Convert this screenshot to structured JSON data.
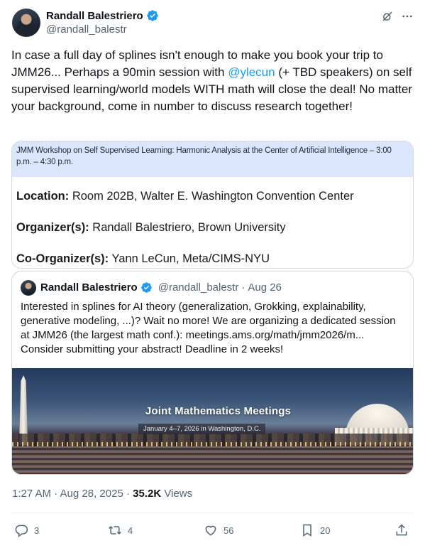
{
  "author": {
    "display_name": "Randall Balestriero",
    "handle": "@randall_balestr"
  },
  "tweet": {
    "text_before_mention": "In case a full day of splines isn't enough to make you book your trip to JMM26... Perhaps a 90min session with ",
    "mention": "@ylecun",
    "text_after_mention": " (+ TBD speakers) on self supervised learning/world models WITH math will close the deal! No matter your background, come in number to discuss research together!"
  },
  "image_card": {
    "header": "JMM Workshop on Self Supervised Learning: Harmonic Analysis at the Center of Artificial Intelligence – 3:00 p.m. – 4:30 p.m.",
    "location_label": "Location:",
    "location_value": " Room 202B, Walter E. Washington Convention Center",
    "organizer_label": "Organizer(s):",
    "organizer_value": " Randall Balestriero, Brown University",
    "coorganizer_label": "Co-Organizer(s):",
    "coorganizer_value": " Yann LeCun, Meta/CIMS-NYU"
  },
  "quote": {
    "display_name": "Randall Balestriero",
    "handle": "@randall_balestr",
    "separator": "·",
    "date": "Aug 26",
    "text": "Interested in splines for AI theory (generalization, Grokking, explainability, generative modeling, ...)? Wait no more! We are organizing a dedicated session at JMM26 (the largest math conf.): meetings.ams.org/math/jmm2026/m... Consider submitting your abstract! Deadline in 2 weeks!",
    "photo_title": "Joint Mathematics Meetings",
    "photo_subtitle": "January 4–7, 2026 in Washington, D.C."
  },
  "meta": {
    "time_date": "1:27 AM · Aug 28, 2025 · ",
    "views_count": "35.2K",
    "views_label": " Views"
  },
  "actions": {
    "replies": "3",
    "reposts": "4",
    "likes": "56",
    "bookmarks": "20"
  },
  "colors": {
    "text": "#0f1419",
    "secondary": "#536471",
    "accent": "#1d9bf0",
    "border": "#cfd9de"
  }
}
